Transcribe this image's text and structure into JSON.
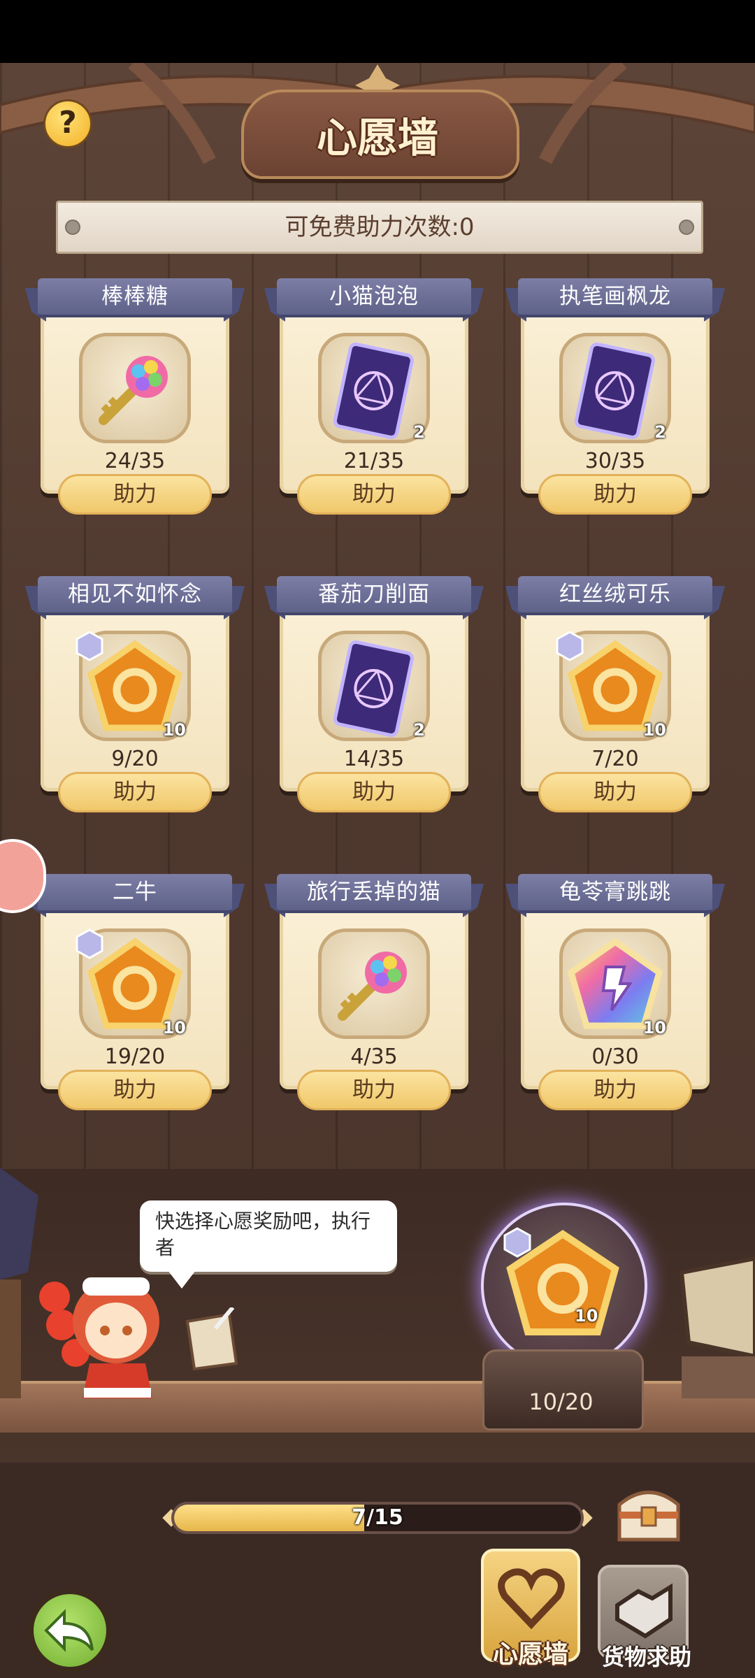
{
  "header": {
    "title": "心愿墙",
    "help_label": "?"
  },
  "free_assist": {
    "label": "可免费助力次数:0"
  },
  "wishes": [
    {
      "name": "棒棒糖",
      "item": "rainbow-key",
      "qty": "",
      "progress": "24/35",
      "button": "助力"
    },
    {
      "name": "小猫泡泡",
      "item": "purple-card",
      "qty": "2",
      "progress": "21/35",
      "button": "助力"
    },
    {
      "name": "执笔画枫龙",
      "item": "purple-card",
      "qty": "2",
      "progress": "30/35",
      "button": "助力"
    },
    {
      "name": "相见不如怀念",
      "item": "gold-medal",
      "qty": "10",
      "progress": "9/20",
      "button": "助力"
    },
    {
      "name": "番茄刀削面",
      "item": "purple-card",
      "qty": "2",
      "progress": "14/35",
      "button": "助力"
    },
    {
      "name": "红丝绒可乐",
      "item": "gold-medal",
      "qty": "10",
      "progress": "7/20",
      "button": "助力"
    },
    {
      "name": "二牛",
      "item": "gold-medal",
      "qty": "10",
      "progress": "19/20",
      "button": "助力"
    },
    {
      "name": "旅行丢掉的猫",
      "item": "rainbow-key",
      "qty": "",
      "progress": "4/35",
      "button": "助力"
    },
    {
      "name": "龟苓膏跳跳",
      "item": "rainbow-medal",
      "qty": "10",
      "progress": "0/30",
      "button": "助力"
    }
  ],
  "npc": {
    "speech": "快选择心愿奖励吧，执行者"
  },
  "my_wish": {
    "item": "gold-medal",
    "qty": "10",
    "progress": "10/20"
  },
  "reward_progress": {
    "text": "7/15",
    "fraction": 0.4667
  },
  "tabs": {
    "wish_wall": "心愿墙",
    "goods_help": "货物求助"
  },
  "colors": {
    "ribbon": "#6d7098",
    "card": "#f7ead0",
    "button": "#f3cf78",
    "wall": "#4f382e"
  }
}
